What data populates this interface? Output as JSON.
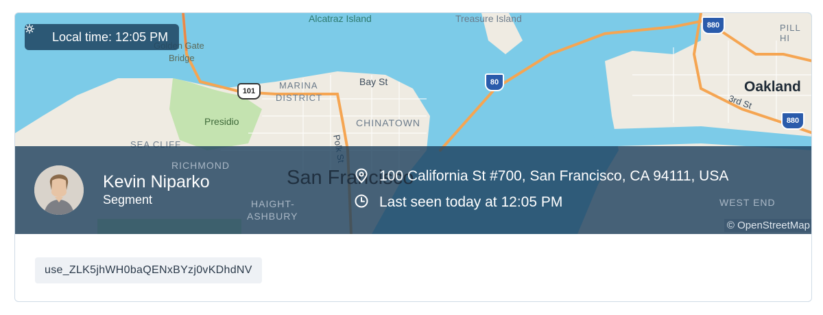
{
  "local_time": {
    "label": "Local time: 12:05 PM",
    "icon": "sun-icon"
  },
  "user": {
    "name": "Kevin Niparko",
    "company": "Segment",
    "address": "100 California St #700, San Francisco, CA 94111, USA",
    "last_seen": "Last seen today at 12:05 PM",
    "user_id": "use_ZLK5jhWH0baQENxBYzj0vKDhdNV"
  },
  "map": {
    "labels": {
      "alcatraz": "Alcatraz Island",
      "treasure": "Treasure Island",
      "golden_gate_1": "Golden Gate",
      "golden_gate_2": "Bridge",
      "marina_1": "MARINA",
      "marina_2": "DISTRICT",
      "bay_st": "Bay St",
      "presidio": "Presidio",
      "chinatown": "CHINATOWN",
      "polk_st": "Polk St",
      "sea_cliff": "SEA CLIFF",
      "richmond": "RICHMOND",
      "san_francisco": "San Francisco",
      "haight_1": "HAIGHT-",
      "haight_2": "ASHBURY",
      "oakland": "Oakland",
      "third_st": "3rd St",
      "pill_hill": "PILL HI",
      "west_end": "WEST END",
      "hwy_101": "101",
      "hwy_80": "80",
      "hwy_880a": "880",
      "hwy_880b": "880"
    },
    "attribution": "© OpenStreetMap",
    "colors": {
      "water": "#7ccbe8",
      "land": "#f0ece3",
      "park": "#c4e3b0",
      "highway": "#f5a552",
      "overlay": "#1c3e5c"
    }
  }
}
